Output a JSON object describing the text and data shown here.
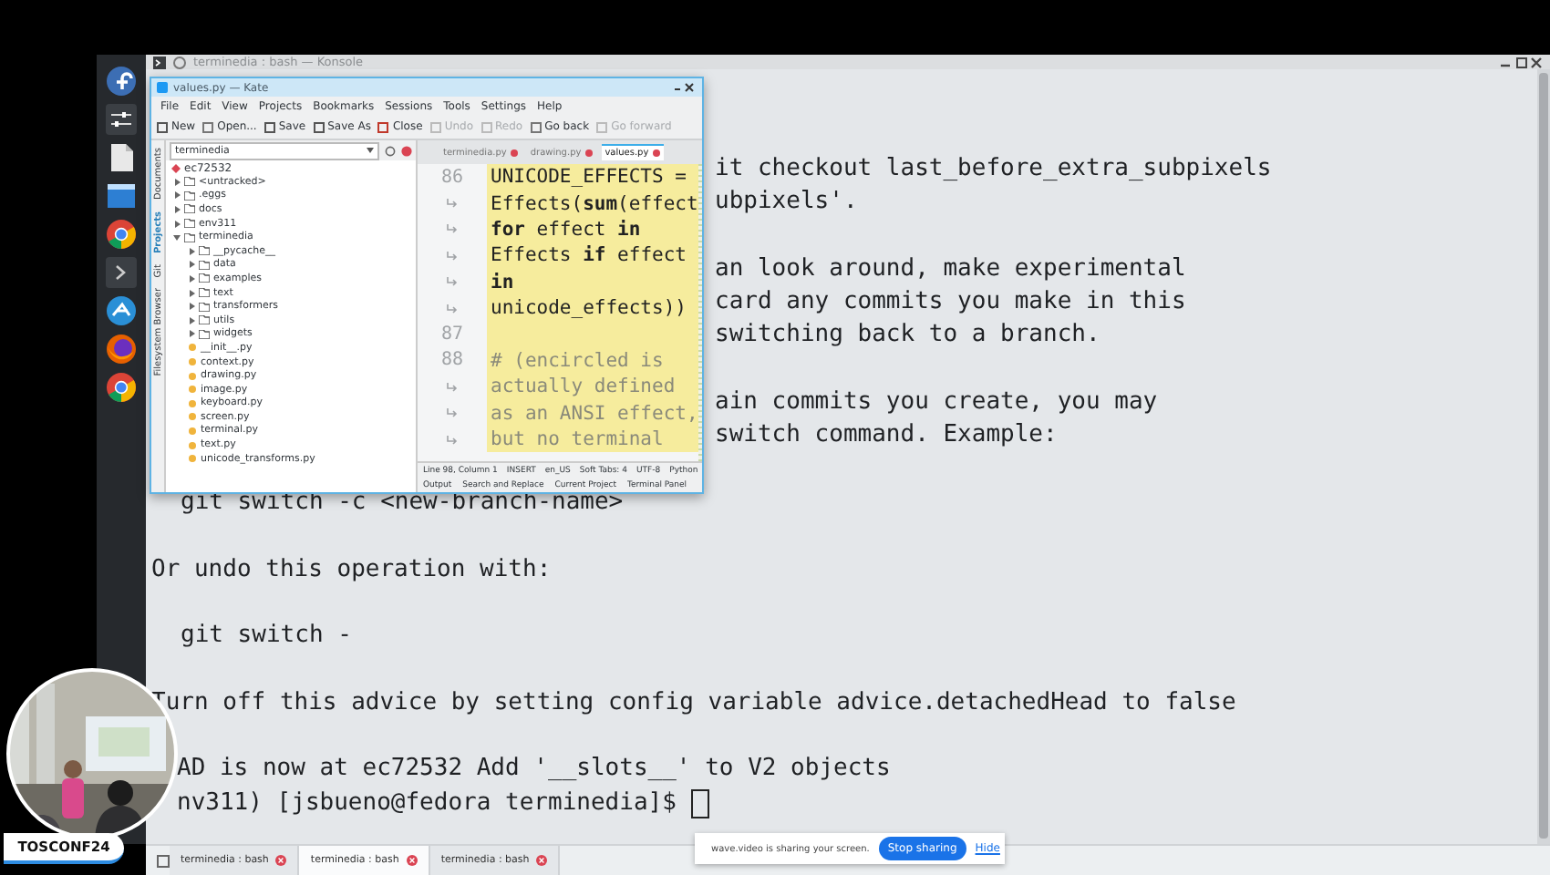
{
  "konsole": {
    "title": "terminedia : bash — Konsole",
    "paragraphs": [
      {
        "kind": "fragment",
        "lines": [
          "it checkout last_before_extra_subpixels",
          "ubpixels'."
        ]
      },
      {
        "kind": "fragment",
        "lines": [
          "an look around, make experimental",
          "card any commits you make in this",
          "switching back to a branch."
        ]
      },
      {
        "kind": "fragment",
        "lines": [
          "ain commits you create, you may",
          "switch command. Example:"
        ]
      },
      {
        "kind": "command",
        "lines": [
          "git switch -c <new-branch-name>"
        ]
      },
      {
        "kind": "text",
        "lines": [
          "Or undo this operation with:"
        ]
      },
      {
        "kind": "command",
        "lines": [
          "git switch -"
        ]
      },
      {
        "kind": "text",
        "lines": [
          "Turn off this advice by setting config variable advice.detachedHead to false"
        ]
      },
      {
        "kind": "prompt",
        "lines": [
          "AD is now at ec72532 Add '__slots__' to V2 objects",
          "nv311) [jsbueno@fedora terminedia]$"
        ]
      }
    ]
  },
  "kate": {
    "title": "values.py — Kate",
    "menu": [
      "File",
      "Edit",
      "View",
      "Projects",
      "Bookmarks",
      "Sessions",
      "Tools",
      "Settings",
      "Help"
    ],
    "toolbar": [
      {
        "label": "New",
        "disabled": false
      },
      {
        "label": "Open...",
        "disabled": false
      },
      {
        "label": "Save",
        "disabled": false
      },
      {
        "label": "Save As",
        "disabled": false
      },
      {
        "label": "Close",
        "disabled": false
      },
      {
        "label": "Undo",
        "disabled": true
      },
      {
        "label": "Redo",
        "disabled": true
      },
      {
        "label": "Go back",
        "disabled": false
      },
      {
        "label": "Go forward",
        "disabled": true
      }
    ],
    "side_tabs": [
      {
        "label": "Documents",
        "selected": false
      },
      {
        "label": "Projects",
        "selected": true
      },
      {
        "label": "Git",
        "selected": false
      },
      {
        "label": "Filesystem Browser",
        "selected": false
      }
    ],
    "project": "terminedia",
    "branch": "ec72532",
    "tree": [
      {
        "label": "<untracked>",
        "kind": "folder",
        "expanded": false
      },
      {
        "label": ".eggs",
        "kind": "folder",
        "expanded": false
      },
      {
        "label": "docs",
        "kind": "folder",
        "expanded": false
      },
      {
        "label": "env311",
        "kind": "folder",
        "expanded": false
      },
      {
        "label": "terminedia",
        "kind": "folder",
        "expanded": true,
        "children": [
          {
            "label": "__pycache__",
            "kind": "folder",
            "expanded": false
          },
          {
            "label": "data",
            "kind": "folder",
            "expanded": false
          },
          {
            "label": "examples",
            "kind": "folder",
            "expanded": false
          },
          {
            "label": "text",
            "kind": "folder",
            "expanded": false
          },
          {
            "label": "transformers",
            "kind": "folder",
            "expanded": false
          },
          {
            "label": "utils",
            "kind": "folder",
            "expanded": false
          },
          {
            "label": "widgets",
            "kind": "folder",
            "expanded": false
          },
          {
            "label": "__init__.py",
            "kind": "file"
          },
          {
            "label": "context.py",
            "kind": "file"
          },
          {
            "label": "drawing.py",
            "kind": "file"
          },
          {
            "label": "image.py",
            "kind": "file"
          },
          {
            "label": "keyboard.py",
            "kind": "file"
          },
          {
            "label": "screen.py",
            "kind": "file"
          },
          {
            "label": "terminal.py",
            "kind": "file"
          },
          {
            "label": "text.py",
            "kind": "file"
          },
          {
            "label": "unicode_transforms.py",
            "kind": "file"
          }
        ]
      }
    ],
    "editor_tabs": [
      {
        "label": "terminedia.py",
        "selected": false
      },
      {
        "label": "drawing.py",
        "selected": false
      },
      {
        "label": "values.py",
        "selected": true
      }
    ],
    "code": [
      {
        "kind": "code",
        "number": "86",
        "text": "UNICODE_EFFECTS ="
      },
      {
        "kind": "code",
        "text": "Effects(**sum**(effect"
      },
      {
        "kind": "code",
        "text": "**for** effect **in**"
      },
      {
        "kind": "code",
        "text": "Effects **if** effect"
      },
      {
        "kind": "keyword",
        "text": "in"
      },
      {
        "kind": "code",
        "text": "unicode_effects))"
      },
      {
        "kind": "blank",
        "number": "87"
      },
      {
        "kind": "comment",
        "number": "88",
        "text": "# (encircled is"
      },
      {
        "kind": "comment",
        "text": "actually defined"
      },
      {
        "kind": "comment",
        "text": "as an ANSI effect,"
      },
      {
        "kind": "comment",
        "text": "but no terminal"
      }
    ],
    "status": [
      "Line 98, Column 1",
      "INSERT",
      "en_US",
      "Soft Tabs: 4",
      "UTF-8",
      "Python"
    ],
    "bottom_tabs": [
      "Output",
      "Search and Replace",
      "Current Project",
      "Terminal Panel"
    ]
  },
  "webcam": {
    "label": "TOSCONF24"
  },
  "taskbar": {
    "tabs": [
      {
        "label": "terminedia : bash",
        "selected": false
      },
      {
        "label": "terminedia : bash",
        "selected": true
      },
      {
        "label": "terminedia : bash",
        "selected": false
      }
    ]
  },
  "share_bar": {
    "message": "wave.video is sharing your screen.",
    "stop": "Stop sharing",
    "hide": "Hide"
  }
}
